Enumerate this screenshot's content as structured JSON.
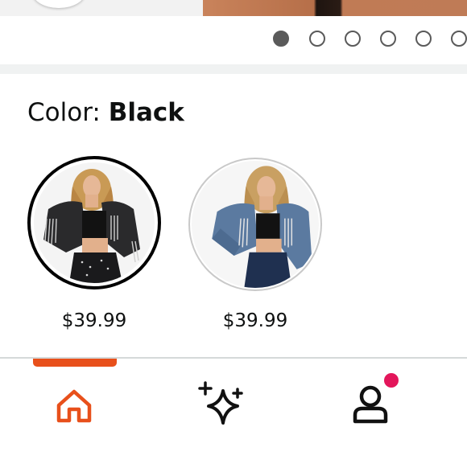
{
  "carousel": {
    "total_images": 6,
    "active_index": 0
  },
  "variation": {
    "label": "Color: ",
    "selected_value": "Black"
  },
  "swatches": [
    {
      "name": "Black",
      "price": "$39.99",
      "selected": true
    },
    {
      "name": "Blue",
      "price": "$39.99",
      "selected": false
    }
  ],
  "nav": {
    "tabs": [
      {
        "icon": "home-icon",
        "active": true
      },
      {
        "icon": "sparkle-icon",
        "active": false
      },
      {
        "icon": "account-icon",
        "active": false
      }
    ],
    "account_notification": true
  },
  "colors": {
    "accent": "#e8501b",
    "badge": "#e3165b",
    "text": "#0f1111"
  }
}
